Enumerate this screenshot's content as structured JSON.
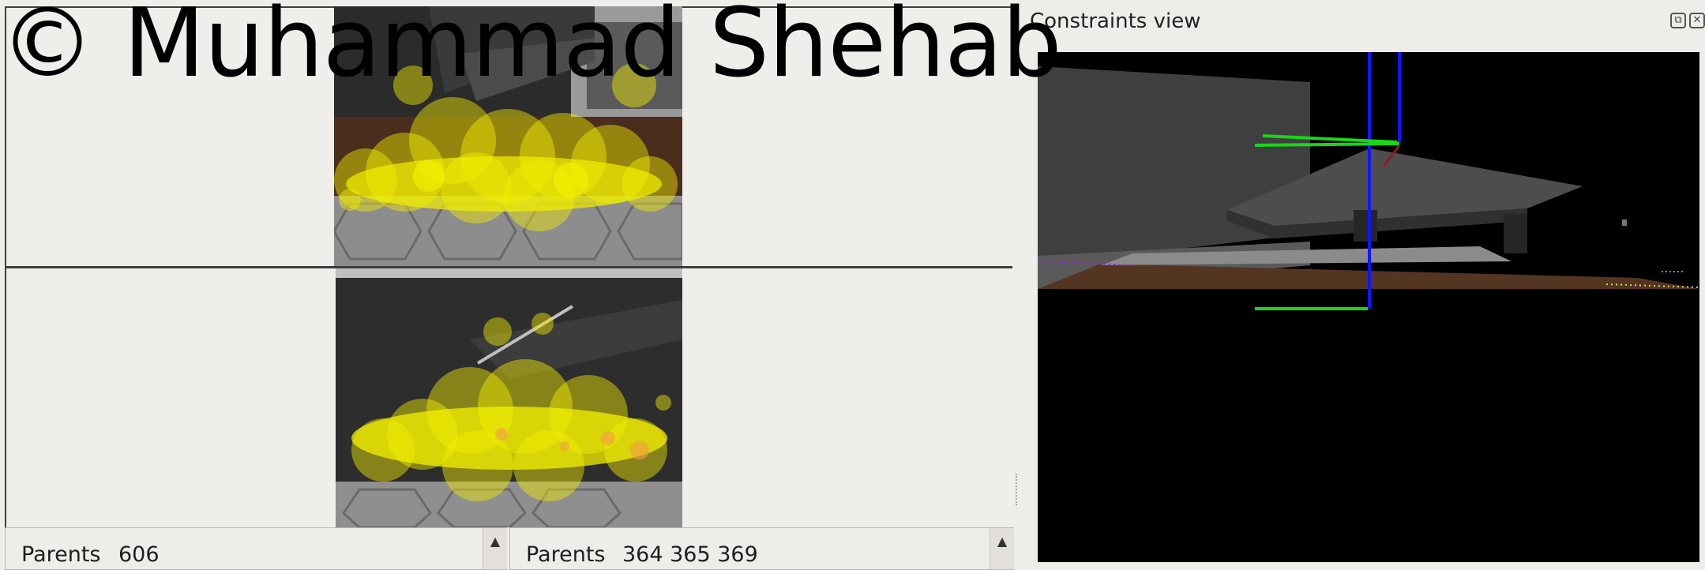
{
  "watermark": "© Muhammad Shehab",
  "panels": {
    "left_list": {
      "label": "Parents",
      "value": "606"
    },
    "right_list": {
      "label": "Parents",
      "value": "364 365 369"
    }
  },
  "constraints_dock": {
    "title": "Constraints view",
    "float_icon": "float-icon",
    "close_icon": "close-icon"
  },
  "colors": {
    "background": "#efedea",
    "particles": "#f4f000",
    "constraint_green": "#19d619",
    "constraint_blue": "#1414ff"
  }
}
